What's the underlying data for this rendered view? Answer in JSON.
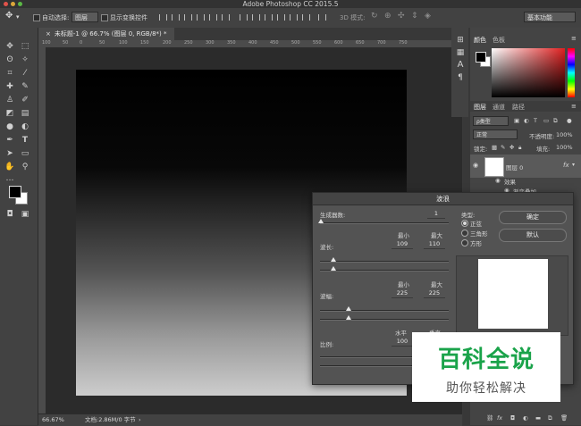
{
  "window": {
    "title": "Adobe Photoshop CC 2015.5"
  },
  "options_bar": {
    "auto_select_label": "自动选择:",
    "layer_select_value": "图层",
    "show_transform_label": "显示变换控件",
    "mode_3d_label": "3D 模式:",
    "workspace_value": "基本功能"
  },
  "document": {
    "tab_title": "未标题-1 @ 66.7% (图层 0, RGB/8*) *",
    "ruler_ticks": [
      "100",
      "50",
      "0",
      "50",
      "100",
      "150",
      "200",
      "250",
      "300",
      "350",
      "400",
      "450",
      "500",
      "550",
      "600",
      "650",
      "700",
      "750"
    ],
    "zoom": "66.67%",
    "doc_info": "文档:2.86M/0 字节"
  },
  "right_panels": {
    "color_tab": "颜色",
    "swatches_tab": "色板",
    "layers_tab": "图层",
    "channels_tab": "通道",
    "paths_tab": "路径",
    "kind_filter": "ρ类型",
    "blend_mode": "正常",
    "opacity_label": "不透明度:",
    "opacity_value": "100%",
    "lock_label": "锁定:",
    "fill_label": "填充:",
    "fill_value": "100%",
    "layer_name": "图层 0",
    "fx_label": "fx",
    "effects_label": "效果",
    "gradient_overlay_label": "渐变叠加"
  },
  "wave_dialog": {
    "title": "波浪",
    "generators_label": "生成器数:",
    "generators_value": "1",
    "wavelength_label": "波长:",
    "min_label": "最小",
    "max_label": "最大",
    "wavelength_min": "109",
    "wavelength_max": "110",
    "amplitude_label": "波幅:",
    "amplitude_min": "225",
    "amplitude_max": "225",
    "scale_label": "比例:",
    "horizontal_label": "水平",
    "vertical_label": "垂直",
    "scale_horizontal": "100",
    "scale_vertical": "100",
    "type_label": "类型:",
    "type_options": [
      "正弦",
      "三角形",
      "方形"
    ],
    "selected_type": "正弦",
    "ok_button": "确定",
    "default_button": "默认"
  },
  "watermark": {
    "line1": "百科全说",
    "line2": "助你轻松解决"
  }
}
